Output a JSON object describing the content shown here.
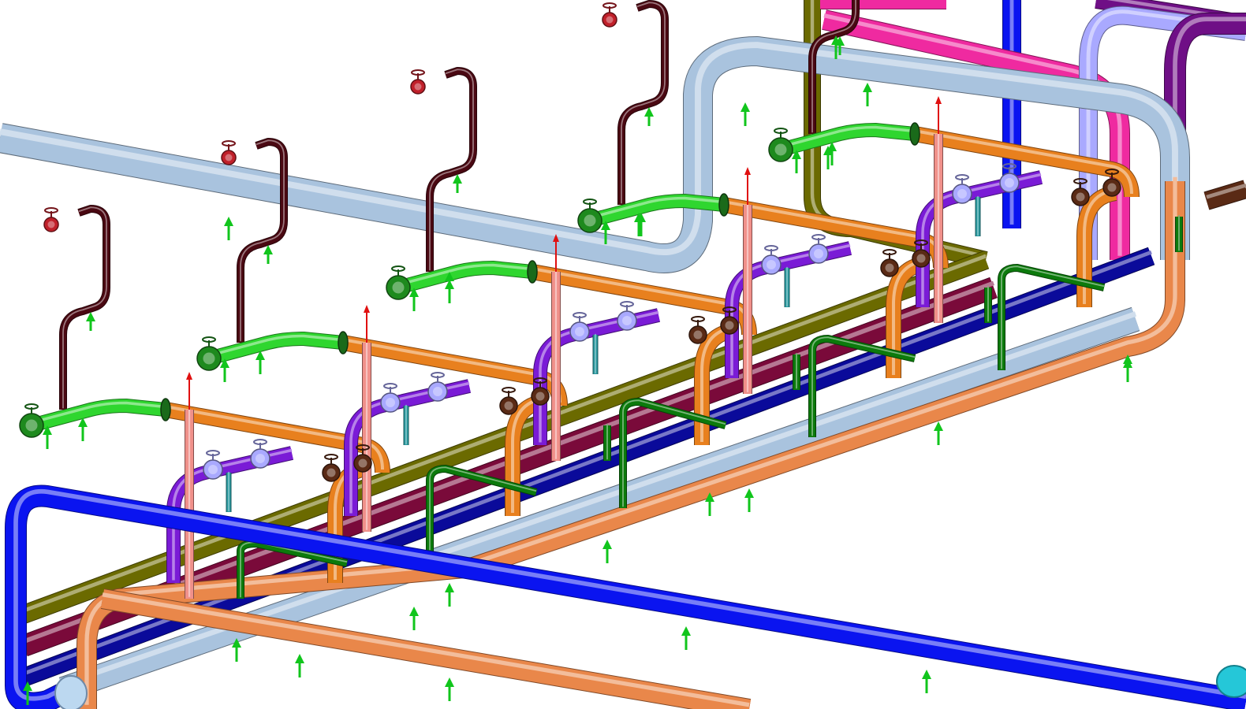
{
  "viewport": {
    "background": "#ffffff"
  },
  "colors": {
    "steam_blue_gray": "#a9c3de",
    "blue": "#0a14f0",
    "navy": "#0a0a9a",
    "orange": "#e8801e",
    "light_orange": "#e9874a",
    "green": "#2fd62f",
    "dark_green": "#0c7a0c",
    "purple": "#7a1bd6",
    "lavender": "#a9a9ff",
    "pink": "#f0908a",
    "maroon": "#4a0812",
    "magenta": "#ef2aa0",
    "olive": "#6b6a00",
    "dark_purple": "#6f0f86",
    "teal": "#2a9aa0",
    "support_arrow": "#11c51c",
    "red_arrow": "#e01010",
    "valve_dark": "#5a2a15"
  },
  "icons": {
    "support_arrow": "up-arrow-icon",
    "valve": "handwheel-valve-icon",
    "flange": "flange-icon",
    "vent": "vent-icon"
  }
}
